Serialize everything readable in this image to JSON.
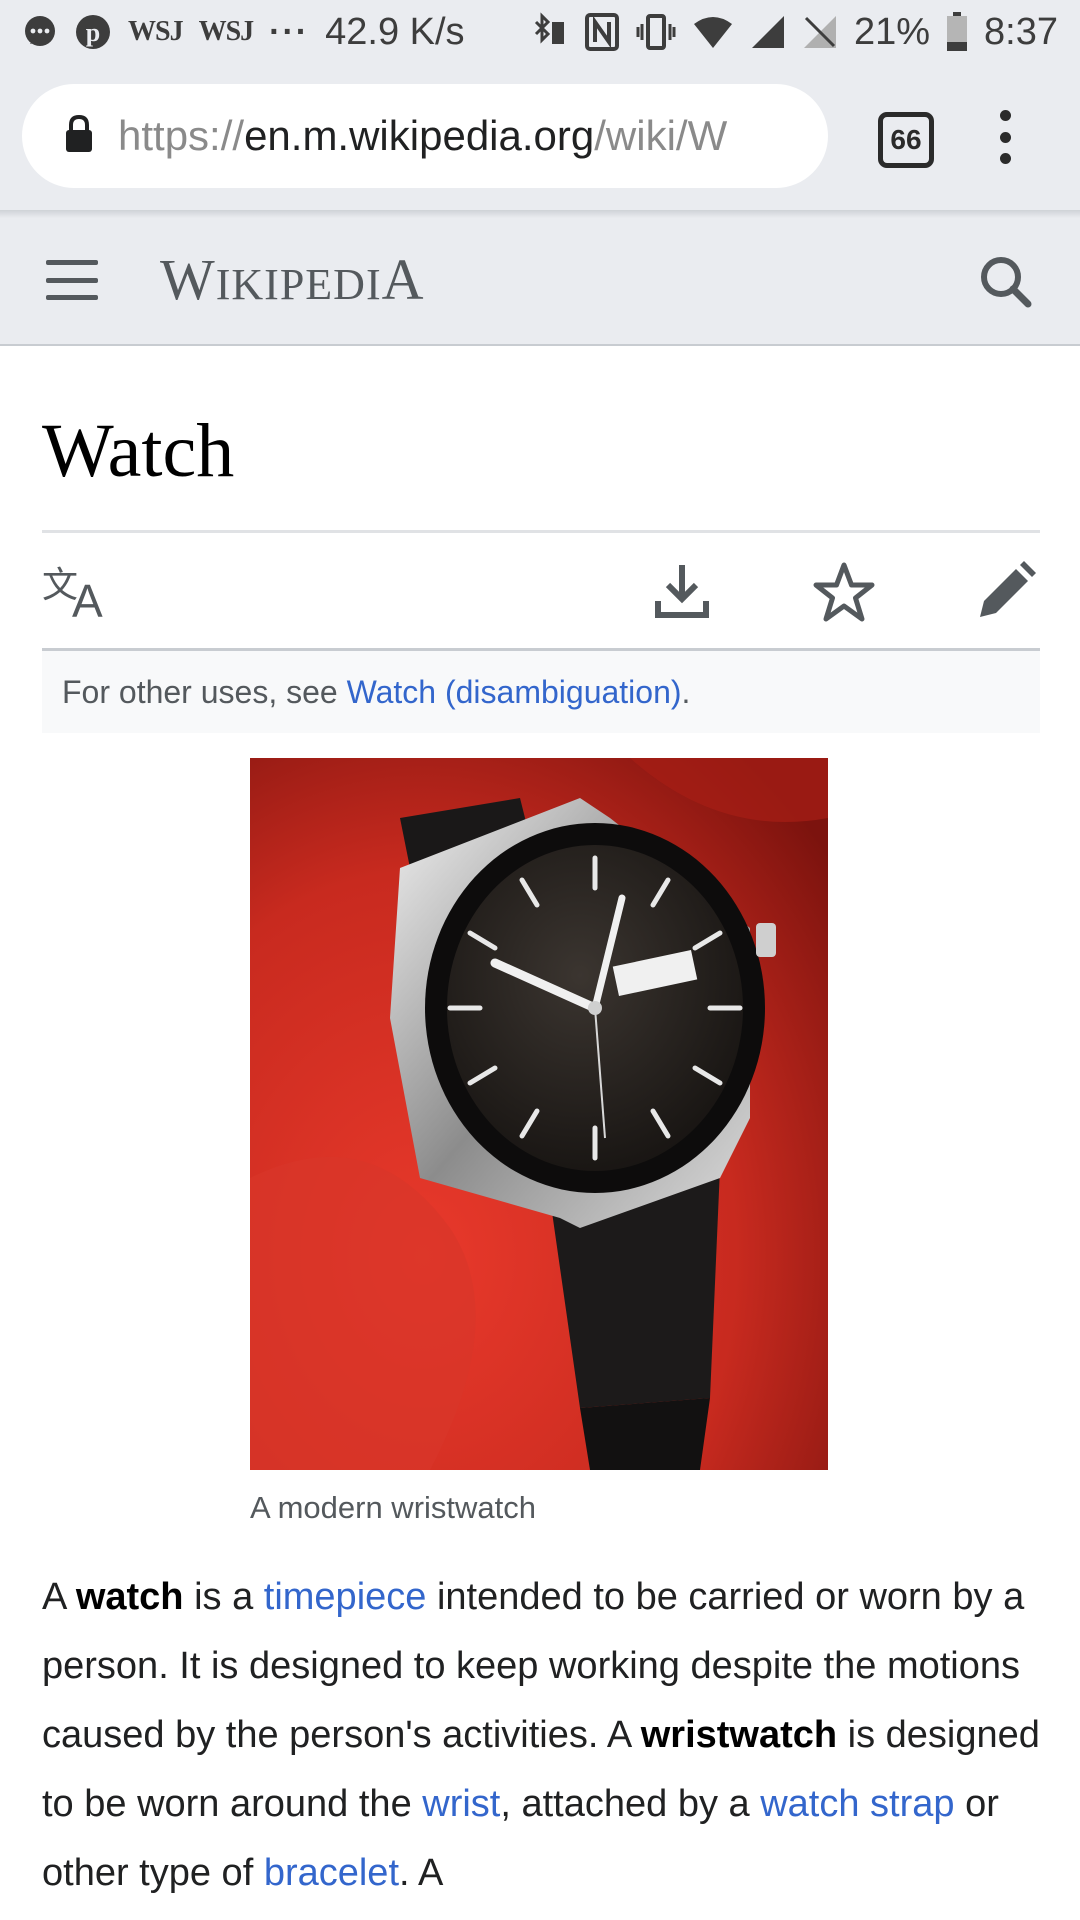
{
  "status_bar": {
    "wsj_1": "WSJ",
    "wsj_2": "WSJ",
    "more": "···",
    "speed": "42.9 K/s",
    "battery": "21%",
    "time": "8:37"
  },
  "browser": {
    "url_scheme": "https://",
    "url_host": "en.m.wikipedia.org",
    "url_path": "/wiki/W",
    "tab_count": "66"
  },
  "wiki": {
    "wordmark_first": "W",
    "wordmark_middle": "IKIPEDI",
    "wordmark_last": "A"
  },
  "article": {
    "title": "Watch",
    "hatnote_prefix": "For other uses, see ",
    "hatnote_link": "Watch (disambiguation)",
    "hatnote_suffix": ".",
    "caption": "A modern wristwatch",
    "intro": {
      "t1": "A ",
      "b1": "watch",
      "t2": " is a ",
      "l1": "timepiece",
      "t3": " intended to be carried or worn by a person. It is designed to keep working despite the motions caused by the person's activities. A ",
      "b2": "wristwatch",
      "t4": " is designed to be worn around the ",
      "l2": "wrist",
      "t5": ", attached by a ",
      "l3": "watch strap",
      "t6": " or other type of ",
      "l4": "bracelet",
      "t7": ". A"
    }
  },
  "icons": {
    "language": "language-icon",
    "download": "download-icon",
    "watch_star": "star-icon",
    "edit": "pencil-icon",
    "search": "search-icon",
    "menu": "hamburger-icon"
  },
  "colors": {
    "link": "#3366cc",
    "header_bg": "#eaecf0",
    "hatnote_bg": "#f8f9fa"
  }
}
